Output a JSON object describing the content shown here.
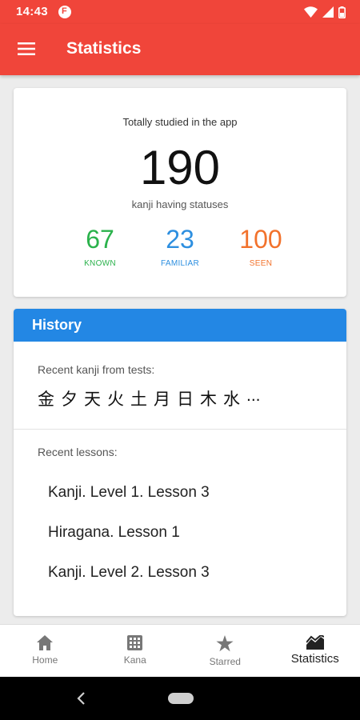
{
  "status_bar": {
    "time": "14:43",
    "icons": [
      "notification-icon",
      "wifi-icon",
      "signal-icon",
      "battery-icon"
    ]
  },
  "app_bar": {
    "title": "Statistics",
    "menu_icon": "hamburger-menu-icon",
    "color": "#f0453a"
  },
  "summary": {
    "caption": "Totally studied in the app",
    "total": "190",
    "subcaption": "kanji having statuses",
    "stats": [
      {
        "value": "67",
        "label": "KNOWN",
        "color": "#2bb24c"
      },
      {
        "value": "23",
        "label": "FAMILIAR",
        "color": "#2d8fe0"
      },
      {
        "value": "100",
        "label": "SEEN",
        "color": "#f2722c"
      }
    ]
  },
  "history": {
    "title": "History",
    "header_color": "#2387e4",
    "recent_kanji_label": "Recent kanji from tests:",
    "recent_kanji": [
      "金",
      "夕",
      "天",
      "火",
      "土",
      "月",
      "日",
      "木",
      "水",
      "..."
    ],
    "recent_lessons_label": "Recent lessons:",
    "lessons": [
      "Kanji. Level 1. Lesson 3",
      "Hiragana. Lesson 1",
      "Kanji. Level 2. Lesson 3"
    ]
  },
  "bottom_nav": {
    "items": [
      {
        "label": "Home",
        "icon": "home-icon",
        "active": false
      },
      {
        "label": "Kana",
        "icon": "grid-icon",
        "active": false
      },
      {
        "label": "Starred",
        "icon": "star-icon",
        "active": false
      },
      {
        "label": "Statistics",
        "icon": "chart-icon",
        "active": true
      }
    ]
  },
  "system_nav": {
    "icons": [
      "back-icon",
      "home-pill-icon"
    ]
  }
}
